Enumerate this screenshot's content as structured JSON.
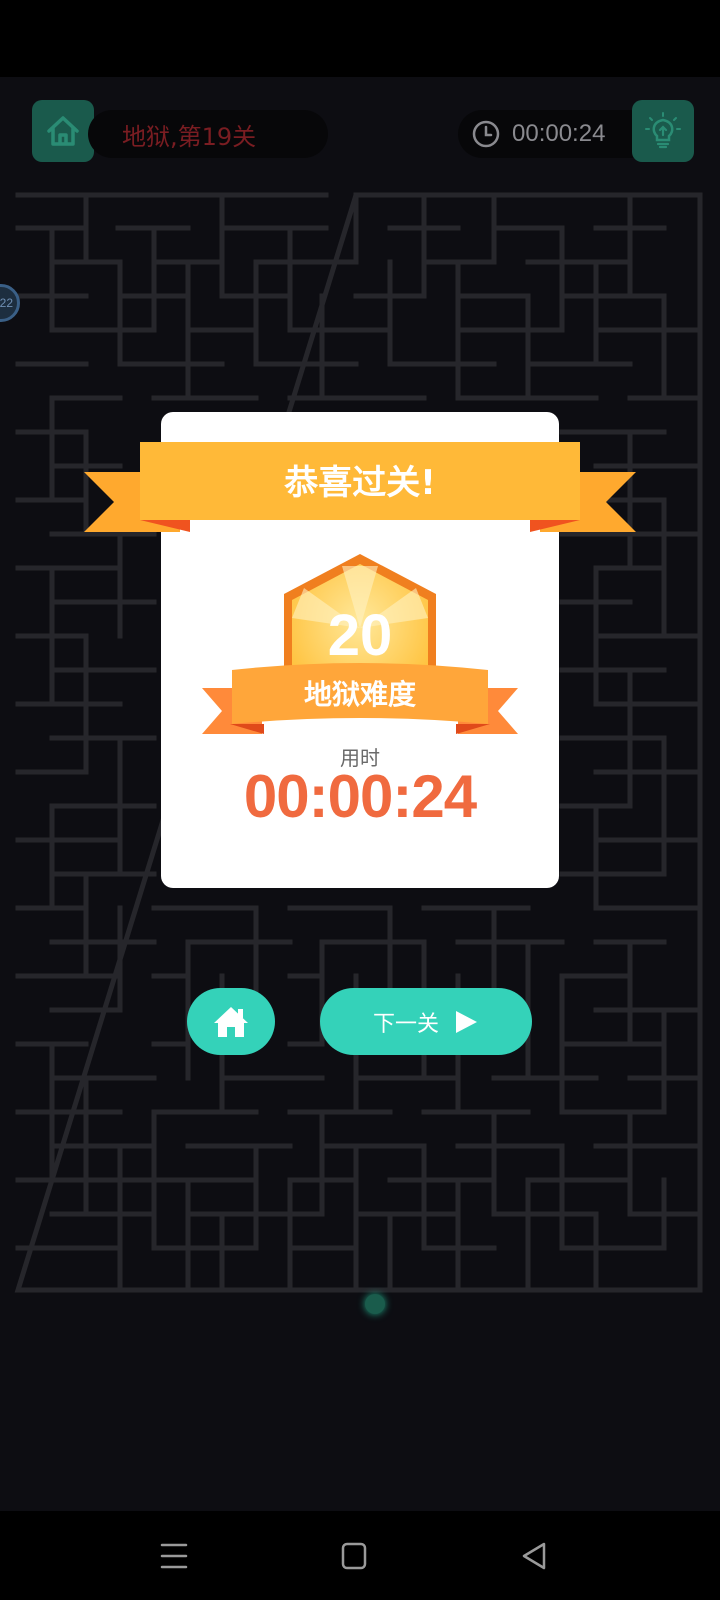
{
  "header": {
    "level_title": "地狱,第19关",
    "timer": "00:00:24"
  },
  "side_marker": {
    "text": "22"
  },
  "dialog": {
    "title": "恭喜过关!",
    "badge_number": "20",
    "badge_label": "地狱难度",
    "time_label": "用时",
    "time_value": "00:00:24"
  },
  "buttons": {
    "next_label": "下一关"
  },
  "colors": {
    "accent": "#34d2b9",
    "ribbon": "#ffb938",
    "time_text": "#f06a3f",
    "level_text": "#7a1d22"
  },
  "icons": {
    "top_left": "home-icon",
    "timer": "clock-icon",
    "top_right": "lightbulb-icon",
    "bottom_home": "home-icon",
    "next": "play-icon",
    "nav": [
      "menu-icon",
      "square-icon",
      "back-triangle-icon"
    ]
  }
}
